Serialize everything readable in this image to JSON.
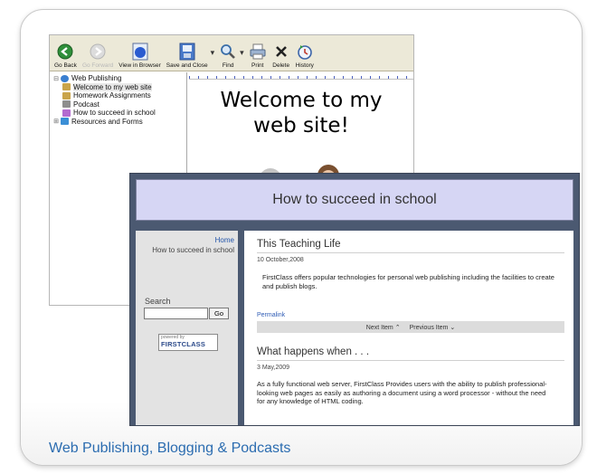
{
  "caption": "Web Publishing, Blogging & Podcasts",
  "editor": {
    "toolbar": [
      {
        "label": "Go Back",
        "icon": "back-arrow-icon",
        "enabled": true
      },
      {
        "label": "Go Forward",
        "icon": "forward-arrow-icon",
        "enabled": false
      },
      {
        "label": "View in Browser",
        "icon": "browser-icon",
        "enabled": true
      },
      {
        "label": "Save and Close",
        "icon": "save-icon",
        "enabled": true
      },
      {
        "label": "Find",
        "icon": "magnifier-icon",
        "enabled": true
      },
      {
        "label": "Print",
        "icon": "printer-icon",
        "enabled": true
      },
      {
        "label": "Delete",
        "icon": "delete-x-icon",
        "enabled": true
      },
      {
        "label": "History",
        "icon": "history-icon",
        "enabled": true
      }
    ],
    "tree": {
      "root": "Web Publishing",
      "items": [
        {
          "label": "Welcome to my web site",
          "selected": true
        },
        {
          "label": "Homework Assignments",
          "selected": false
        },
        {
          "label": "Podcast",
          "selected": false
        },
        {
          "label": "How to succeed in school",
          "selected": false
        },
        {
          "label": "Resources and Forms",
          "selected": false
        }
      ]
    },
    "preview": {
      "heading_line1": "Welcome to my",
      "heading_line2": "web site!"
    }
  },
  "blog": {
    "header_title": "How to succeed in school",
    "sidebar": {
      "home_link": "Home",
      "current_page": "How to succeed in school",
      "search_label": "Search",
      "search_value": "",
      "go_label": "Go",
      "powered_by": "powered by",
      "powered_brand": "FIRSTCLASS"
    },
    "posts": [
      {
        "title": "This Teaching Life",
        "date": "10 October,2008",
        "body": "FirstClass offers popular technologies for personal web publishing including the facilities to create and publish blogs.",
        "permalink": "Permalink"
      },
      {
        "title": "What happens when . . .",
        "date": "3 May,2009",
        "body": "As a fully functional web server, FirstClass Provides users with the ability to publish professional-looking web pages as easily as authoring a document using a word processor - without the need for any knowledge of HTML coding."
      }
    ],
    "nav": {
      "next_label": "Next Item",
      "prev_label": "Previous Item"
    }
  },
  "colors": {
    "blog_frame": "#4b5971",
    "blog_header_bg": "#d6d6f4",
    "caption_text": "#2b6cb0",
    "link": "#2f5cb5"
  }
}
